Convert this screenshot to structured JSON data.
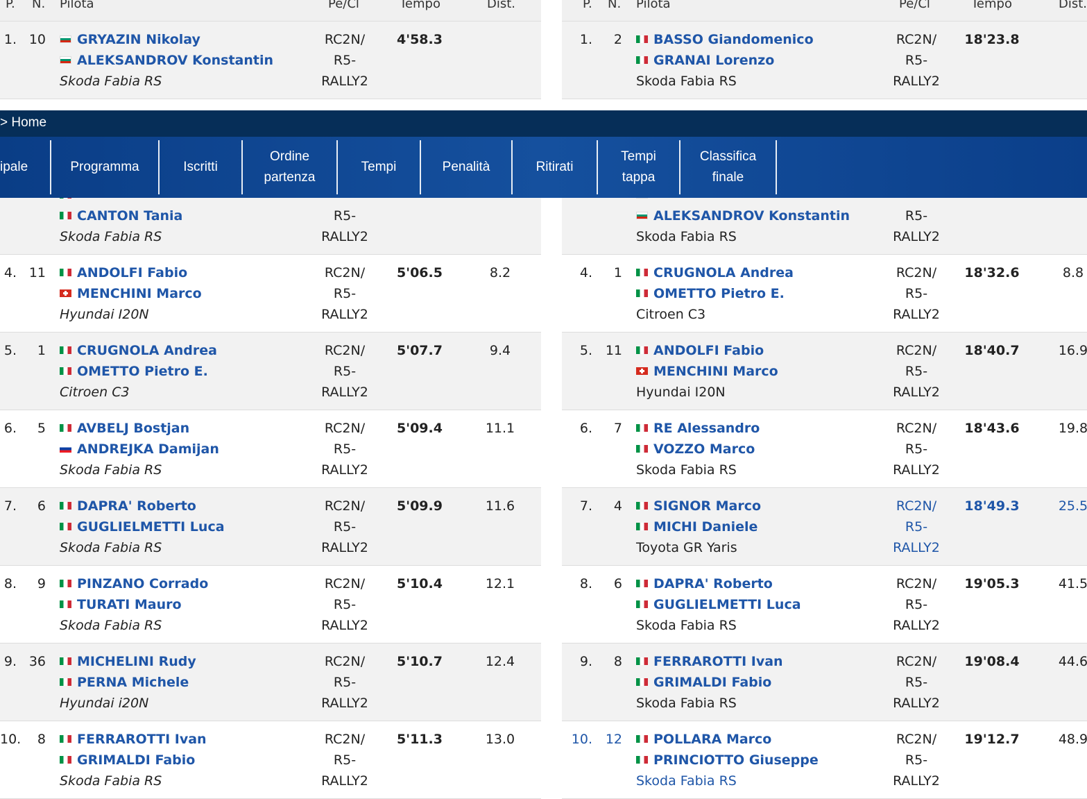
{
  "headers": {
    "pos": "P.",
    "num": "N.",
    "driver": "Pilota",
    "class": "Pe/Cl",
    "time": "Tempo",
    "dist": "Dist."
  },
  "breadcrumb": "> Home",
  "menu": [
    {
      "label": "ipale"
    },
    {
      "label": "Programma"
    },
    {
      "label": "Iscritti"
    },
    {
      "label": "Ordine partenza",
      "l1": "Ordine",
      "l2": "partenza"
    },
    {
      "label": "Tempi"
    },
    {
      "label": "Penalità"
    },
    {
      "label": "Ritirati"
    },
    {
      "label": "Tempi tappa",
      "l1": "Tempi",
      "l2": "tappa"
    },
    {
      "label": "Classifica finale",
      "l1": "Classifica",
      "l2": "finale"
    }
  ],
  "left_table": {
    "rows": [
      {
        "pos": "1.",
        "num": "10",
        "d1": "GRYAZIN Nikolay",
        "f1": "bg",
        "d2": "ALEKSANDROV Konstantin",
        "f2": "bg",
        "car": "Skoda Fabia RS",
        "cls1": "RC2N/",
        "cls2": "R5-",
        "cls3": "RALLY2",
        "time": "4'58.3",
        "dist": ""
      },
      {
        "pos": "",
        "num": "",
        "d1": "",
        "f1": "",
        "d2": "",
        "f2": "",
        "car": "",
        "cls1": "",
        "cls2": "",
        "cls3": "",
        "time": "",
        "dist": ""
      },
      {
        "pos": "",
        "num": "",
        "d1": "",
        "f1": "it",
        "d2": "CANTON Tania",
        "f2": "it",
        "car": "Skoda Fabia RS",
        "cls1": "",
        "cls2": "R5-",
        "cls3": "RALLY2",
        "time": "",
        "dist": ""
      },
      {
        "pos": "4.",
        "num": "11",
        "d1": "ANDOLFI Fabio",
        "f1": "it",
        "d2": "MENCHINI Marco",
        "f2": "ch",
        "car": "Hyundai I20N",
        "cls1": "RC2N/",
        "cls2": "R5-",
        "cls3": "RALLY2",
        "time": "5'06.5",
        "dist": "8.2"
      },
      {
        "pos": "5.",
        "num": "1",
        "d1": "CRUGNOLA Andrea",
        "f1": "it",
        "d2": "OMETTO Pietro E.",
        "f2": "it",
        "car": "Citroen C3",
        "cls1": "RC2N/",
        "cls2": "R5-",
        "cls3": "RALLY2",
        "time": "5'07.7",
        "dist": "9.4"
      },
      {
        "pos": "6.",
        "num": "5",
        "d1": "AVBELJ Bostjan",
        "f1": "it",
        "d2": "ANDREJKA Damijan",
        "f2": "si",
        "car": "Skoda Fabia RS",
        "cls1": "RC2N/",
        "cls2": "R5-",
        "cls3": "RALLY2",
        "time": "5'09.4",
        "dist": "11.1"
      },
      {
        "pos": "7.",
        "num": "6",
        "d1": "DAPRA' Roberto",
        "f1": "it",
        "d2": "GUGLIELMETTI Luca",
        "f2": "it",
        "car": "Skoda Fabia RS",
        "cls1": "RC2N/",
        "cls2": "R5-",
        "cls3": "RALLY2",
        "time": "5'09.9",
        "dist": "11.6"
      },
      {
        "pos": "8.",
        "num": "9",
        "d1": "PINZANO Corrado",
        "f1": "it",
        "d2": "TURATI Mauro",
        "f2": "it",
        "car": "Skoda Fabia RS",
        "cls1": "RC2N/",
        "cls2": "R5-",
        "cls3": "RALLY2",
        "time": "5'10.4",
        "dist": "12.1"
      },
      {
        "pos": "9.",
        "num": "36",
        "d1": "MICHELINI Rudy",
        "f1": "it",
        "d2": "PERNA Michele",
        "f2": "it",
        "car": "Hyundai i20N",
        "cls1": "RC2N/",
        "cls2": "R5-",
        "cls3": "RALLY2",
        "time": "5'10.7",
        "dist": "12.4"
      },
      {
        "pos": "10.",
        "num": "8",
        "d1": "FERRAROTTI Ivan",
        "f1": "it",
        "d2": "GRIMALDI Fabio",
        "f2": "it",
        "car": "Skoda Fabia RS",
        "cls1": "RC2N/",
        "cls2": "R5-",
        "cls3": "RALLY2",
        "time": "5'11.3",
        "dist": "13.0"
      }
    ]
  },
  "right_table": {
    "rows": [
      {
        "pos": "1.",
        "num": "2",
        "d1": "BASSO Giandomenico",
        "f1": "it",
        "d2": "GRANAI Lorenzo",
        "f2": "it",
        "car": "Skoda Fabia RS",
        "cls1": "RC2N/",
        "cls2": "R5-",
        "cls3": "RALLY2",
        "time": "18'23.8",
        "dist": ""
      },
      {
        "pos": "",
        "num": "",
        "d1": "",
        "f1": "",
        "d2": "",
        "f2": "",
        "car": "",
        "cls1": "",
        "cls2": "",
        "cls3": "",
        "time": "",
        "dist": ""
      },
      {
        "pos": "",
        "num": "",
        "d1": "",
        "f1": "bg",
        "d2": "ALEKSANDROV Konstantin",
        "f2": "bg",
        "car": "Skoda Fabia RS",
        "cls1": "",
        "cls2": "R5-",
        "cls3": "RALLY2",
        "time": "",
        "dist": ""
      },
      {
        "pos": "4.",
        "num": "1",
        "d1": "CRUGNOLA Andrea",
        "f1": "it",
        "d2": "OMETTO Pietro E.",
        "f2": "it",
        "car": "Citroen C3",
        "cls1": "RC2N/",
        "cls2": "R5-",
        "cls3": "RALLY2",
        "time": "18'32.6",
        "dist": "8.8"
      },
      {
        "pos": "5.",
        "num": "11",
        "d1": "ANDOLFI Fabio",
        "f1": "it",
        "d2": "MENCHINI Marco",
        "f2": "ch",
        "car": "Hyundai I20N",
        "cls1": "RC2N/",
        "cls2": "R5-",
        "cls3": "RALLY2",
        "time": "18'40.7",
        "dist": "16.9"
      },
      {
        "pos": "6.",
        "num": "7",
        "d1": "RE Alessandro",
        "f1": "it",
        "d2": "VOZZO Marco",
        "f2": "it",
        "car": "Skoda Fabia RS",
        "cls1": "RC2N/",
        "cls2": "R5-",
        "cls3": "RALLY2",
        "time": "18'43.6",
        "dist": "19.8"
      },
      {
        "pos": "7.",
        "num": "4",
        "d1": "SIGNOR Marco",
        "f1": "it",
        "d2": "MICHI Daniele",
        "f2": "it",
        "car": "Toyota GR Yaris",
        "cls1": "RC2N/",
        "cls2": "R5-",
        "cls3": "RALLY2",
        "time": "18'49.3",
        "dist": "25.5",
        "hl": "cls"
      },
      {
        "pos": "8.",
        "num": "6",
        "d1": "DAPRA' Roberto",
        "f1": "it",
        "d2": "GUGLIELMETTI Luca",
        "f2": "it",
        "car": "Skoda Fabia RS",
        "cls1": "RC2N/",
        "cls2": "R5-",
        "cls3": "RALLY2",
        "time": "19'05.3",
        "dist": "41.5"
      },
      {
        "pos": "9.",
        "num": "8",
        "d1": "FERRAROTTI Ivan",
        "f1": "it",
        "d2": "GRIMALDI Fabio",
        "f2": "it",
        "car": "Skoda Fabia RS",
        "cls1": "RC2N/",
        "cls2": "R5-",
        "cls3": "RALLY2",
        "time": "19'08.4",
        "dist": "44.6"
      },
      {
        "pos": "10.",
        "num": "12",
        "d1": "POLLARA Marco",
        "f1": "it",
        "d2": "PRINCIOTTO Giuseppe",
        "f2": "it",
        "car": "Skoda Fabia RS",
        "cls1": "RC2N/",
        "cls2": "R5-",
        "cls3": "RALLY2",
        "time": "19'12.7",
        "dist": "48.9",
        "hl": "pos"
      }
    ]
  }
}
